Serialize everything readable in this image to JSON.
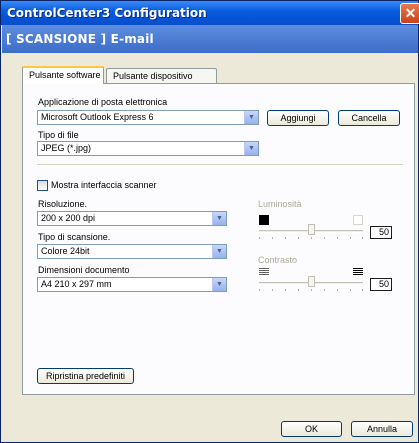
{
  "window": {
    "title": "ControlCenter3 Configuration",
    "close_glyph": "✕"
  },
  "header": {
    "text": "[ SCANSIONE ]  E-mail"
  },
  "tabs": [
    {
      "label": "Pulsante software"
    },
    {
      "label": "Pulsante dispositivo"
    }
  ],
  "email_app": {
    "label": "Applicazione di posta elettronica",
    "value": "Microsoft Outlook Express 6"
  },
  "buttons": {
    "add": "Aggiungi",
    "delete": "Cancella",
    "restore": "Ripristina predefiniti",
    "ok": "OK",
    "cancel": "Annulla"
  },
  "file_type": {
    "label": "Tipo di file",
    "value": "JPEG (*.jpg)"
  },
  "show_scanner": {
    "label": "Mostra interfaccia scanner",
    "checked": false
  },
  "resolution": {
    "label": "Risoluzione.",
    "value": "200 x 200 dpi"
  },
  "scan_type": {
    "label": "Tipo di scansione.",
    "value": "Colore 24bit"
  },
  "doc_size": {
    "label": "Dimensioni documento",
    "value": "A4 210 x 297 mm"
  },
  "brightness": {
    "label": "Luminosità",
    "value": "50"
  },
  "contrast": {
    "label": "Contrasto",
    "value": "50"
  },
  "icons": {
    "dropdown": "chevron-down-icon"
  }
}
